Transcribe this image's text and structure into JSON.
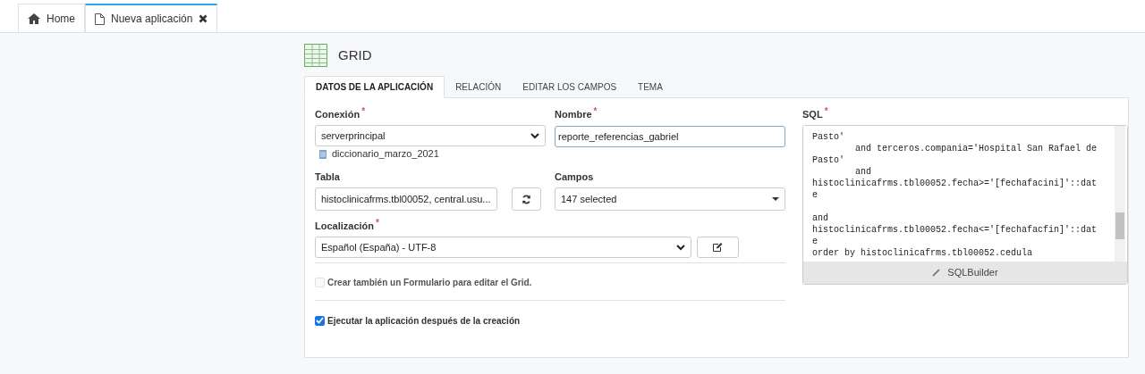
{
  "top_tabs": [
    {
      "label": "Home",
      "kind": "home",
      "closable": false,
      "selected": false
    },
    {
      "label": "Nueva aplicación",
      "kind": "document",
      "closable": true,
      "selected": true
    }
  ],
  "header": {
    "title": "GRID"
  },
  "tabs": [
    {
      "label": "DATOS DE LA APLICACIÓN",
      "selected": true
    },
    {
      "label": "RELACIÓN",
      "selected": false
    },
    {
      "label": "EDITAR LOS CAMPOS",
      "selected": false
    },
    {
      "label": "TEMA",
      "selected": false
    }
  ],
  "form": {
    "conexion": {
      "label": "Conexión",
      "required_mark": "*",
      "value": "serverprincipal",
      "note": "diccionario_marzo_2021"
    },
    "nombre": {
      "label": "Nombre",
      "required_mark": "*",
      "value": "reporte_referencias_gabriel"
    },
    "tabla": {
      "label": "Tabla",
      "value": "histoclinicafrms.tbl00052, central.usu..."
    },
    "campos": {
      "label": "Campos",
      "value": "147 selected"
    },
    "localizacion": {
      "label": "Localización",
      "required_mark": "*",
      "value": "Español (España) - UTF-8"
    },
    "checkboxes": [
      {
        "label": "Crear también un Formulario para editar el Grid.",
        "checked": false,
        "disabled": true
      },
      {
        "label": "Ejecutar la aplicación después de la creación",
        "checked": true,
        "disabled": false
      }
    ]
  },
  "sql": {
    "label": "SQL",
    "required_mark": "*",
    "text": "Pasto'\n        and terceros.compania='Hospital San Rafael de\nPasto'\n        and\nhistoclinicafrms.tbl00052.fecha>='[fechafacini]'::dat\ne\n\nand\nhistoclinicafrms.tbl00052.fecha<='[fechafacfin]'::dat\ne\norder by histoclinicafrms.tbl00052.cedula",
    "button": "SQLBuilder"
  }
}
